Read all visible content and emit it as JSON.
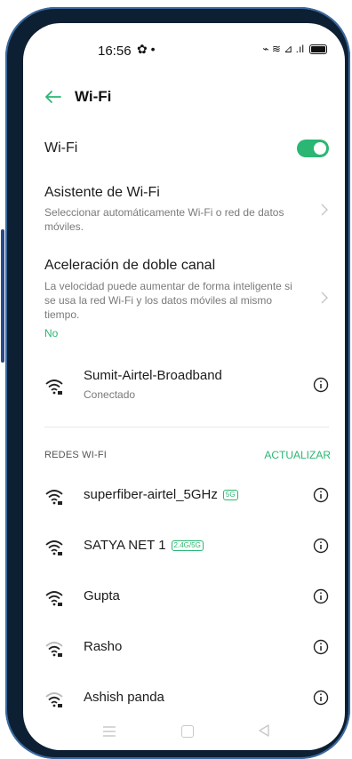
{
  "status": {
    "time": "16:56",
    "left_icons": "✿ •",
    "right_icons": "⌁ ≋ ⊿ .ıl"
  },
  "header": {
    "title": "Wi-Fi"
  },
  "wifi_toggle": {
    "label": "Wi-Fi",
    "state": "on"
  },
  "assistant": {
    "title": "Asistente de Wi-Fi",
    "description": "Seleccionar automáticamente Wi-Fi o red de datos móviles."
  },
  "dual_channel": {
    "title": "Aceleración de doble canal",
    "description": "La velocidad puede aumentar de forma inteligente si se usa la red Wi-Fi y los datos móviles al mismo tiempo.",
    "value": "No"
  },
  "connected": {
    "name": "Sumit-Airtel-Broadband",
    "status": "Conectado"
  },
  "networks_section": {
    "title": "REDES WI-FI",
    "refresh_label": "ACTUALIZAR"
  },
  "networks": [
    {
      "name": "superfiber-airtel_5GHz",
      "badge": "5G"
    },
    {
      "name": "SATYA NET 1",
      "badge": "2.4G/5G"
    },
    {
      "name": "Gupta",
      "badge": ""
    },
    {
      "name": "Rasho",
      "badge": ""
    },
    {
      "name": "Ashish panda",
      "badge": ""
    }
  ],
  "colors": {
    "accent": "#2bb673",
    "frame": "#0d1f33"
  }
}
